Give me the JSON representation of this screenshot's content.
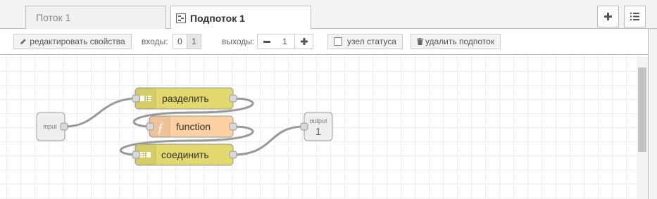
{
  "tabs": [
    {
      "label": "Поток 1",
      "active": false
    },
    {
      "label": "Подпоток 1",
      "active": true
    }
  ],
  "tab_icons": [
    "plus-icon",
    "list-icon"
  ],
  "toolbar": {
    "edit_label": "редактировать свойства",
    "inputs_label": "входы:",
    "inputs_options": [
      "0",
      "1"
    ],
    "inputs_selected": "1",
    "outputs_label": "выходы:",
    "outputs_value": "1",
    "status_label": "узел статуса",
    "status_checked": false,
    "delete_label": "удалить подпоток"
  },
  "nodes": {
    "input_label": "input",
    "split_label": "разделить",
    "function_label": "function",
    "join_label": "соединить",
    "output_label": "output",
    "output_number": "1"
  },
  "colors": {
    "split_join": "#e2d96e",
    "function": "#fdd0a2",
    "port_node": "#eeeeee",
    "wire": "#999999"
  }
}
